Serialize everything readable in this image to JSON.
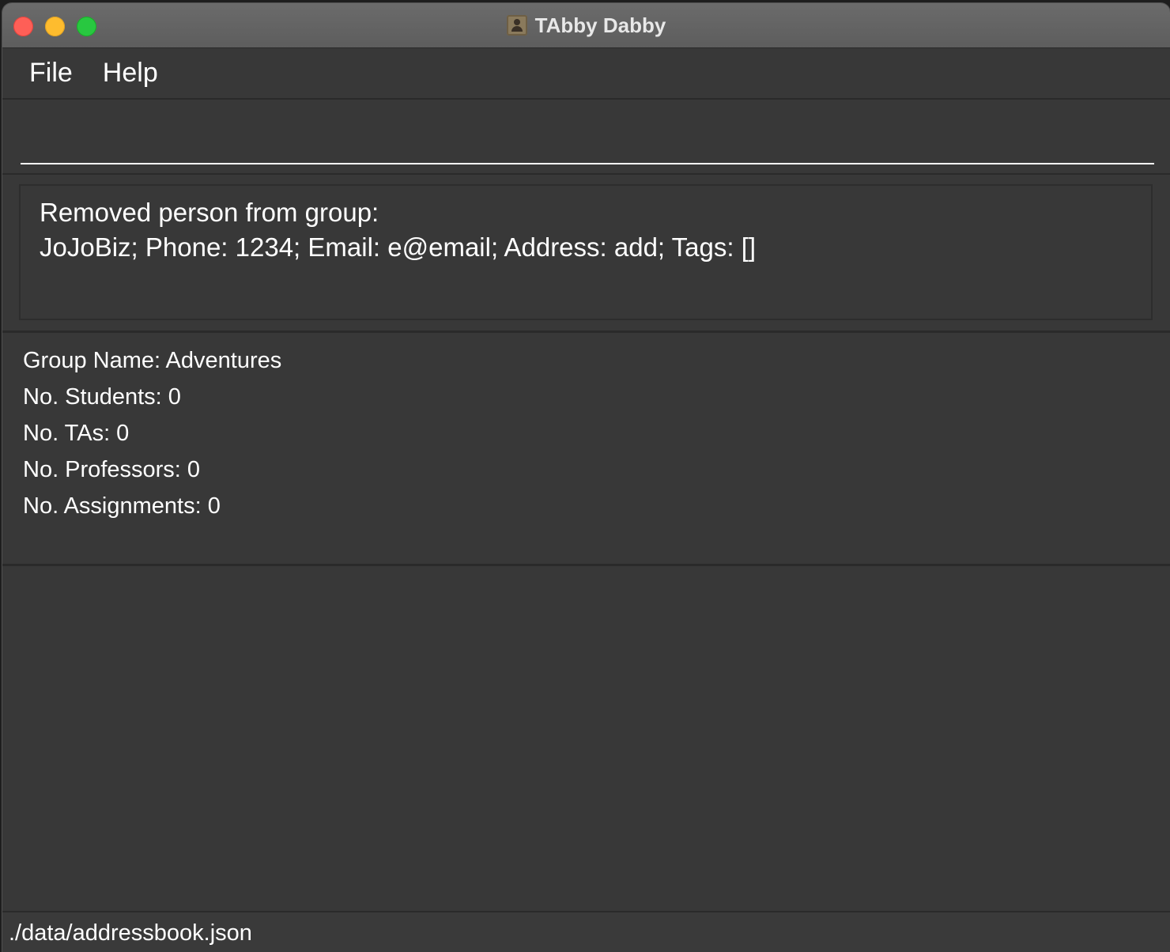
{
  "window": {
    "title": "TAbby Dabby"
  },
  "menu": {
    "items": [
      "File",
      "Help"
    ]
  },
  "command": {
    "value": "",
    "placeholder": ""
  },
  "result": {
    "lines": [
      "Removed person from group:",
      "JoJoBiz; Phone: 1234; Email: e@email; Address: add; Tags: []"
    ]
  },
  "group": {
    "name_line": "Group Name: Adventures",
    "students_line": "No. Students: 0",
    "tas_line": "No. TAs: 0",
    "professors_line": "No. Professors: 0",
    "assignments_line": "No. Assignments: 0"
  },
  "status": {
    "file_path": "./data/addressbook.json"
  },
  "colors": {
    "background": "#383838",
    "titlebar": "#5d5d5d",
    "text": "#ffffff",
    "close": "#fe5f57",
    "minimize": "#febc2e",
    "maximize": "#28c840"
  }
}
